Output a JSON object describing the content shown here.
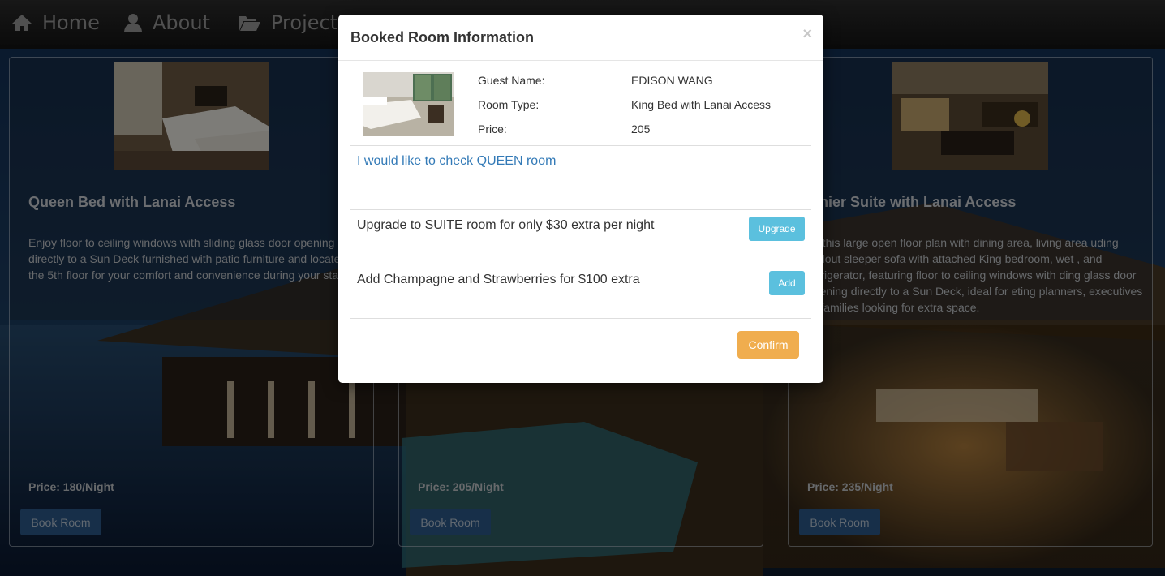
{
  "nav": {
    "items": [
      {
        "label": "Home",
        "icon": "home-icon"
      },
      {
        "label": "About",
        "icon": "user-icon"
      },
      {
        "label": "Projects",
        "icon": "folder-open-icon"
      }
    ]
  },
  "cards": [
    {
      "title": "Queen Bed with Lanai Access",
      "description": "Enjoy floor to ceiling windows with sliding glass door opening directly to a Sun Deck furnished with patio furniture and located on the 5th floor for your comfort and convenience during your stay.",
      "price": "Price: 180/Night",
      "button": "Book Room"
    },
    {
      "title": "",
      "description": "",
      "price": "Price: 205/Night",
      "button": "Book Room"
    },
    {
      "title": "emier Suite with Lanai Access",
      "description": "oy this large open floor plan with dining area, living area uding pullout sleeper sofa with attached King bedroom, wet , and refrigerator, featuring floor to ceiling windows with ding glass door opening directly to a Sun Deck, ideal for eting planners, executives or families looking for extra space.",
      "price": "Price: 235/Night",
      "button": "Book Room"
    }
  ],
  "modal": {
    "title": "Booked Room Information",
    "close": "×",
    "guest_label": "Guest Name:",
    "guest_value": "EDISON WANG",
    "room_type_label": "Room Type:",
    "room_type_value": "King Bed with Lanai Access",
    "price_label": "Price:",
    "price_value": "205",
    "queen_link": "I would like to check QUEEN room",
    "upgrade_text": "Upgrade to SUITE room for only $30 extra per night",
    "upgrade_button": "Upgrade",
    "addon_text": "Add Champagne and Strawberries for $100 extra",
    "add_button": "Add",
    "confirm_button": "Confirm"
  },
  "colors": {
    "link": "#337ab7",
    "info_button": "#5bc0de",
    "confirm_button": "#f0ad4e",
    "book_button": "#2c5a8c"
  }
}
